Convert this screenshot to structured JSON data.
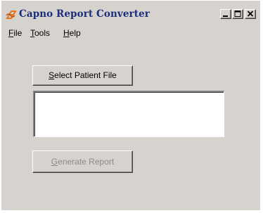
{
  "window": {
    "title": "Capno Report Converter",
    "icon": "app-logo-icon"
  },
  "caption_buttons": [
    {
      "name": "minimize",
      "icon": "minimize-icon"
    },
    {
      "name": "maximize",
      "icon": "maximize-icon"
    },
    {
      "name": "close",
      "icon": "close-icon"
    }
  ],
  "menu": {
    "file": {
      "mnemonic": "F",
      "rest": "ile"
    },
    "tools": {
      "mnemonic": "T",
      "rest": "ools"
    },
    "help": {
      "mnemonic": "H",
      "rest": "elp"
    }
  },
  "select_button": {
    "mnemonic": "S",
    "rest": "elect Patient File"
  },
  "patient_file_box": {
    "value": ""
  },
  "generate_button": {
    "mnemonic": "G",
    "rest": "enerate Report",
    "enabled": false
  },
  "colors": {
    "window_face": "#d6d3ce",
    "title_text": "#1a2c7a",
    "icon_orange": "#e8741c",
    "disabled_text": "#8c8a86"
  }
}
